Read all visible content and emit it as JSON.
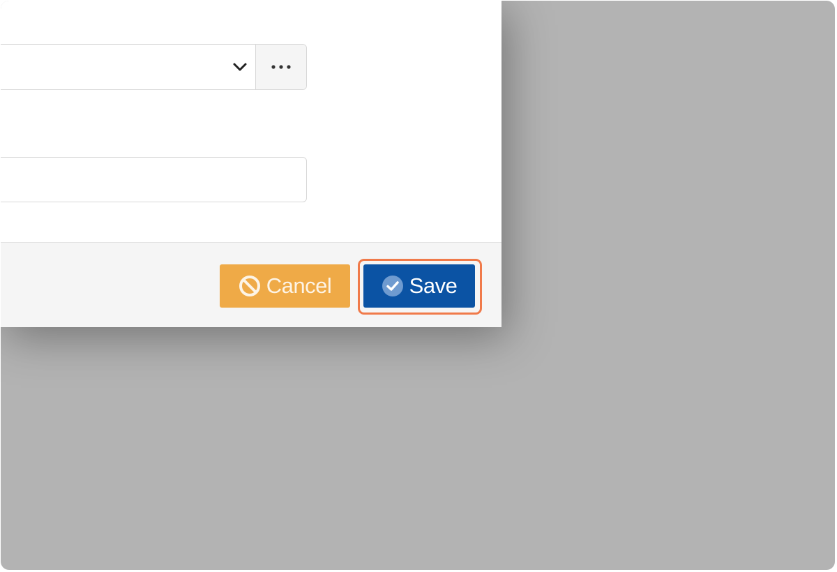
{
  "dialog": {
    "select": {
      "value": "",
      "chevron_icon": "chevron-down-icon",
      "more_label": "···",
      "more_icon": "ellipsis-icon"
    },
    "text_field": {
      "value": "",
      "placeholder": ""
    },
    "footer": {
      "cancel_label": "Cancel",
      "cancel_icon": "ban-icon",
      "save_label": "Save",
      "save_icon": "check-circle-icon"
    }
  },
  "colors": {
    "backdrop": "#b3b3b3",
    "cancel": "#efaa47",
    "save": "#0b53a4",
    "highlight": "#f07a4a"
  }
}
